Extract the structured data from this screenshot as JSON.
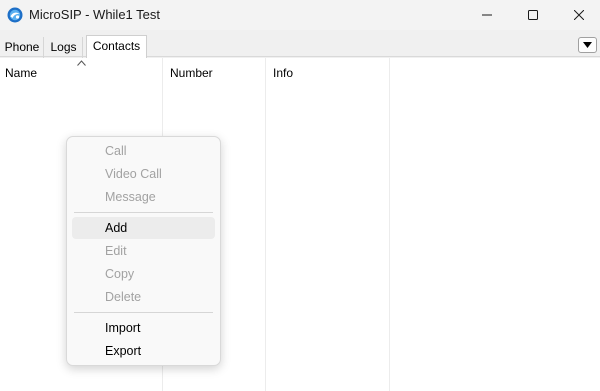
{
  "window": {
    "title": "MicroSIP - While1 Test",
    "icon": "microsip-globe-icon",
    "controls": {
      "minimize": "minimize-icon",
      "maximize": "maximize-icon",
      "close": "close-icon"
    }
  },
  "tabs": [
    {
      "label": "Phone",
      "active": false
    },
    {
      "label": "Logs",
      "active": false
    },
    {
      "label": "Contacts",
      "active": true
    }
  ],
  "tab_menu_icon": "dropdown-arrow-icon",
  "contacts": {
    "columns": [
      "Name",
      "Number",
      "Info"
    ],
    "sort_indicator": "sort-up-icon",
    "rows": []
  },
  "context_menu": {
    "items": [
      {
        "label": "Call",
        "enabled": false
      },
      {
        "label": "Video Call",
        "enabled": false
      },
      {
        "label": "Message",
        "enabled": false
      },
      {
        "separator": true
      },
      {
        "label": "Add",
        "enabled": true,
        "hovered": true
      },
      {
        "label": "Edit",
        "enabled": false
      },
      {
        "label": "Copy",
        "enabled": false
      },
      {
        "label": "Delete",
        "enabled": false
      },
      {
        "separator": true
      },
      {
        "label": "Import",
        "enabled": true
      },
      {
        "label": "Export",
        "enabled": true
      }
    ]
  },
  "colors": {
    "titlebar_bg": "#f3f3f3",
    "disabled_text": "#a2a2a2",
    "menu_hover": "#ececec"
  }
}
